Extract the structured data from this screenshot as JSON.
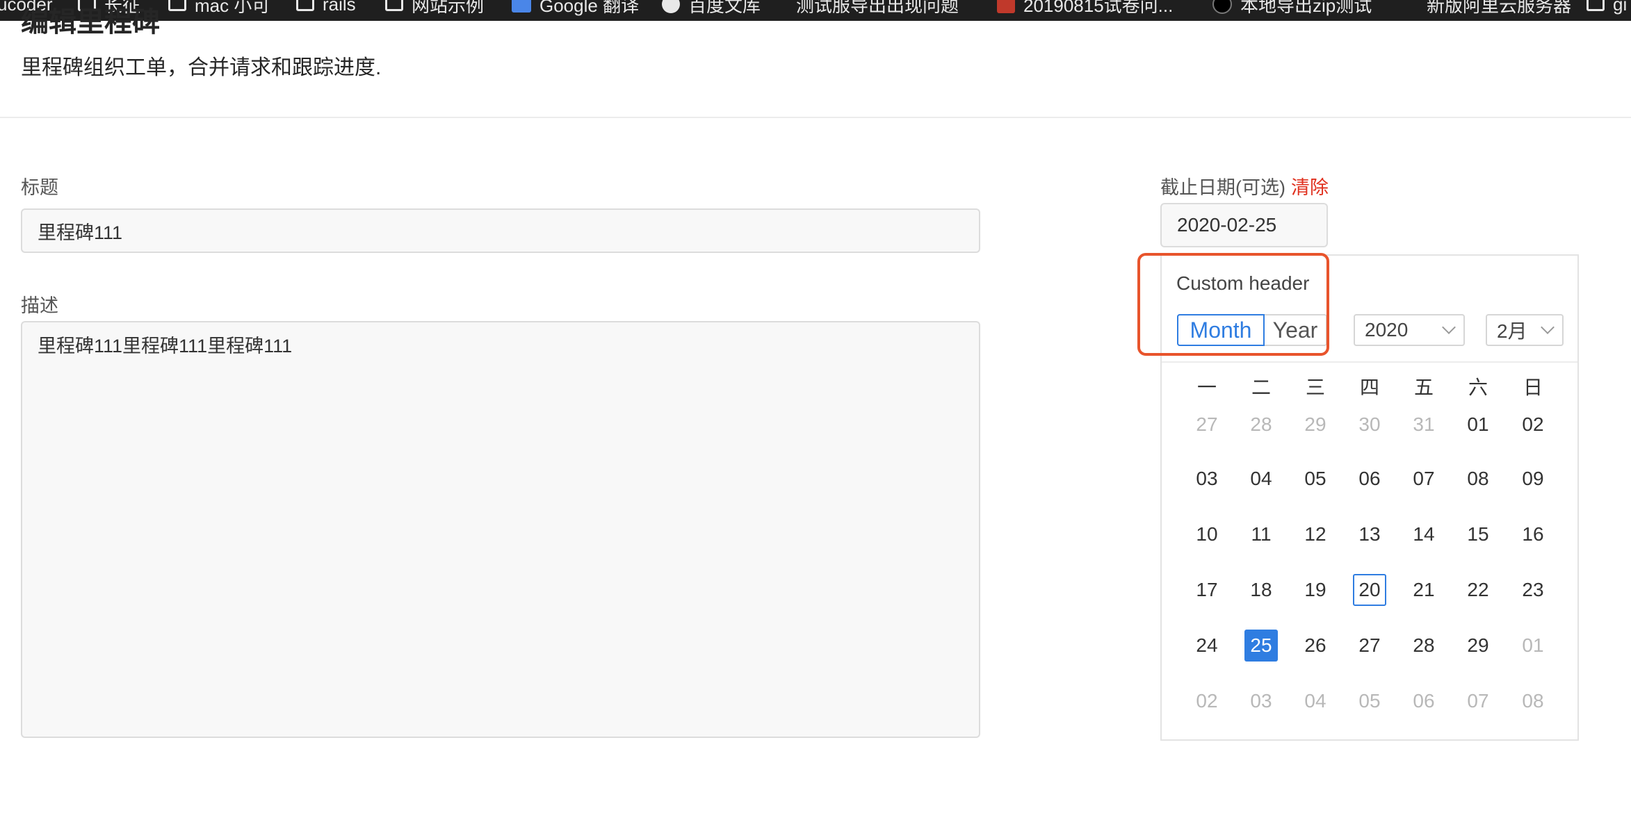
{
  "bookmarks": [
    {
      "label": "ucoder",
      "icon": "none"
    },
    {
      "label": "长征",
      "icon": "folder-icon"
    },
    {
      "label": "mac 小可",
      "icon": "folder-icon"
    },
    {
      "label": "rails",
      "icon": "folder-icon"
    },
    {
      "label": "网站示例",
      "icon": "folder-icon"
    },
    {
      "label": "Google 翻译",
      "icon": "translate-icon"
    },
    {
      "label": "百度文库",
      "icon": "round-icon"
    },
    {
      "label": "测试服导出出现问题",
      "icon": "none"
    },
    {
      "label": "20190815试卷问...",
      "icon": "red-icon"
    },
    {
      "label": "本地导出zip测试",
      "icon": "dot-icon"
    },
    {
      "label": "新版阿里云服务器",
      "icon": "none"
    },
    {
      "label": "gi",
      "icon": "folder-icon"
    }
  ],
  "page": {
    "title": "编辑里程碑",
    "description": "里程碑组织工单，合并请求和跟踪进度."
  },
  "form": {
    "title_label": "标题",
    "title_value": "里程碑111",
    "description_label": "描述",
    "description_value": "里程碑111里程碑111里程碑111",
    "due_date_label": "截止日期(可选)",
    "clear_label": "清除",
    "due_date_value": "2020-02-25"
  },
  "calendar": {
    "header_title": "Custom header",
    "mode_month": "Month",
    "mode_year": "Year",
    "year_value": "2020",
    "month_value": "2月",
    "weekdays": [
      "一",
      "二",
      "三",
      "四",
      "五",
      "六",
      "日"
    ],
    "weeks": [
      [
        {
          "d": "27",
          "m": true
        },
        {
          "d": "28",
          "m": true
        },
        {
          "d": "29",
          "m": true
        },
        {
          "d": "30",
          "m": true
        },
        {
          "d": "31",
          "m": true
        },
        {
          "d": "01"
        },
        {
          "d": "02"
        }
      ],
      [
        {
          "d": "03"
        },
        {
          "d": "04"
        },
        {
          "d": "05"
        },
        {
          "d": "06"
        },
        {
          "d": "07"
        },
        {
          "d": "08"
        },
        {
          "d": "09"
        }
      ],
      [
        {
          "d": "10"
        },
        {
          "d": "11"
        },
        {
          "d": "12"
        },
        {
          "d": "13"
        },
        {
          "d": "14"
        },
        {
          "d": "15"
        },
        {
          "d": "16"
        }
      ],
      [
        {
          "d": "17"
        },
        {
          "d": "18"
        },
        {
          "d": "19"
        },
        {
          "d": "20",
          "today": true
        },
        {
          "d": "21"
        },
        {
          "d": "22"
        },
        {
          "d": "23"
        }
      ],
      [
        {
          "d": "24"
        },
        {
          "d": "25",
          "selected": true
        },
        {
          "d": "26"
        },
        {
          "d": "27"
        },
        {
          "d": "28"
        },
        {
          "d": "29"
        },
        {
          "d": "01",
          "m": true
        }
      ],
      [
        {
          "d": "02",
          "m": true
        },
        {
          "d": "03",
          "m": true
        },
        {
          "d": "04",
          "m": true
        },
        {
          "d": "05",
          "m": true
        },
        {
          "d": "06",
          "m": true
        },
        {
          "d": "07",
          "m": true
        },
        {
          "d": "08",
          "m": true
        }
      ]
    ]
  },
  "colors": {
    "accent": "#2f7de1",
    "danger": "#e0301e",
    "highlight": "#e8542c"
  }
}
